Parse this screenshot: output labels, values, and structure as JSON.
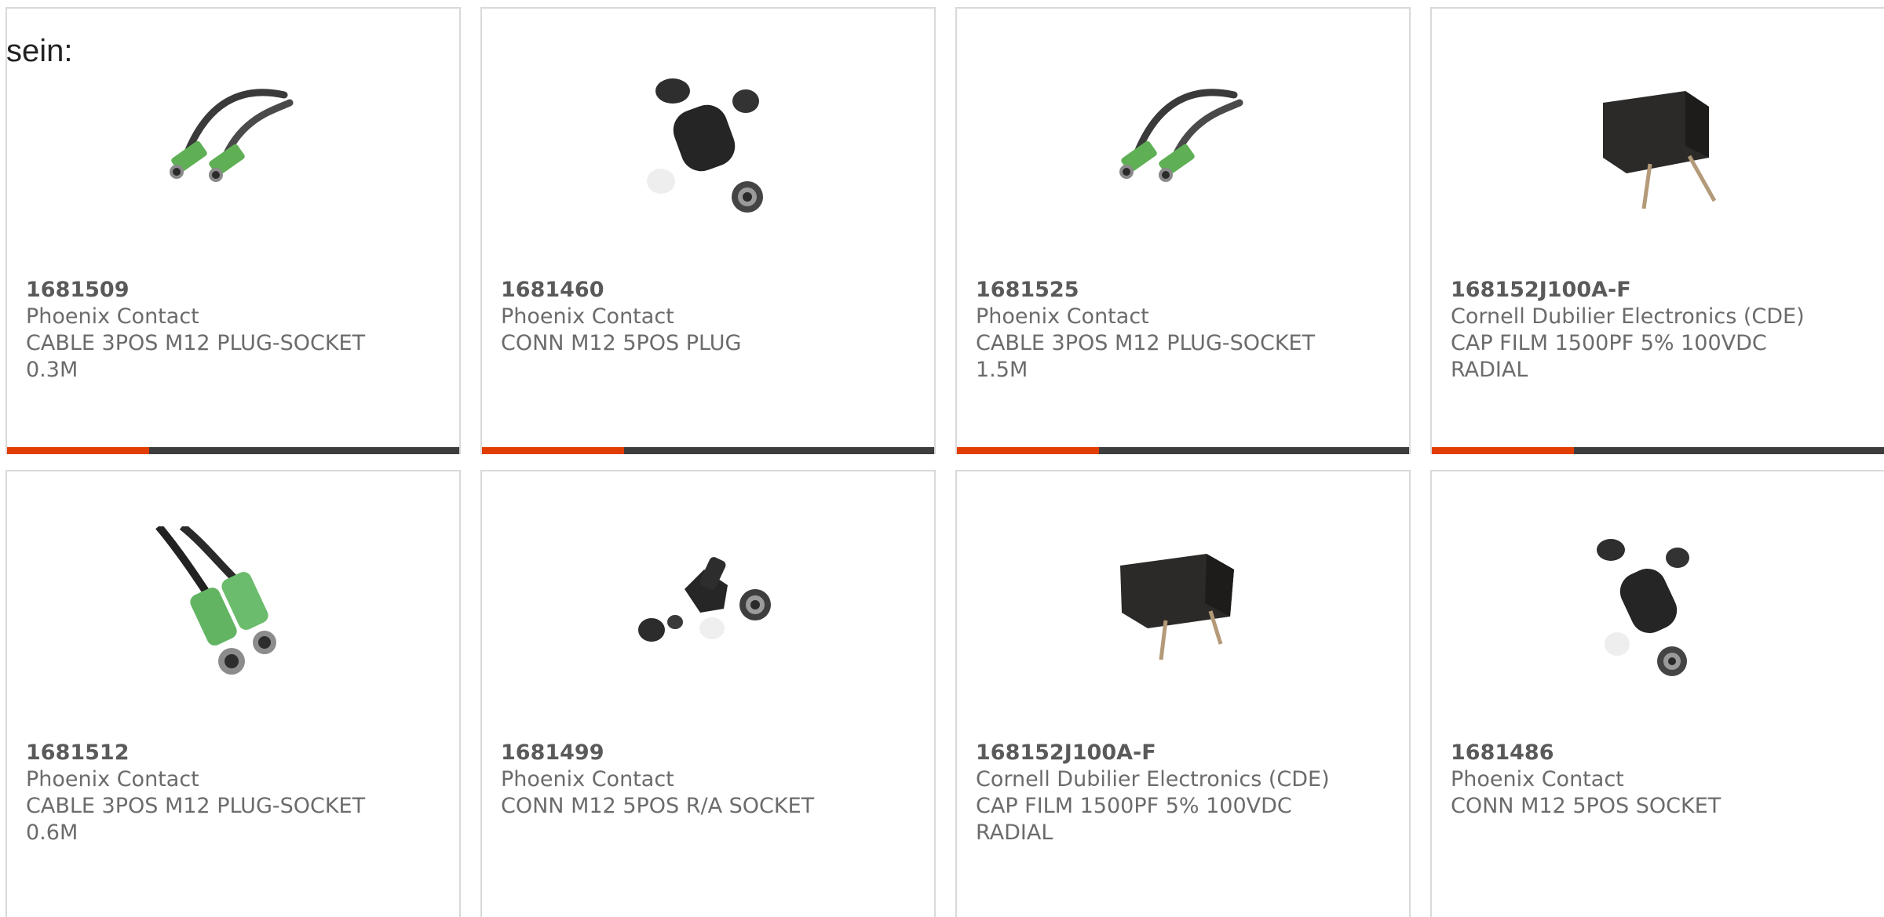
{
  "heading": "sein:",
  "colors": {
    "accent": "#e23d00",
    "bar": "#3d3d3d",
    "border": "#d9d9d9",
    "text": "#6b6b6b"
  },
  "cards": [
    {
      "part_number": "1681509",
      "manufacturer": "Phoenix Contact",
      "desc_line1": "CABLE 3POS M12 PLUG-SOCKET",
      "desc_line2": "0.3M",
      "image": "m12-cable-icon"
    },
    {
      "part_number": "1681460",
      "manufacturer": "Phoenix Contact",
      "desc_line1": "CONN M12 5POS PLUG",
      "desc_line2": "",
      "image": "m12-connector-kit-icon"
    },
    {
      "part_number": "1681525",
      "manufacturer": "Phoenix Contact",
      "desc_line1": "CABLE 3POS M12 PLUG-SOCKET",
      "desc_line2": "1.5M",
      "image": "m12-cable-icon"
    },
    {
      "part_number": "168152J100A-F",
      "manufacturer": "Cornell Dubilier Electronics (CDE)",
      "desc_line1": "CAP FILM 1500PF 5% 100VDC",
      "desc_line2": "RADIAL",
      "image": "film-capacitor-icon"
    },
    {
      "part_number": "1681512",
      "manufacturer": "Phoenix Contact",
      "desc_line1": "CABLE 3POS M12 PLUG-SOCKET",
      "desc_line2": "0.6M",
      "image": "m12-cable-closeup-icon"
    },
    {
      "part_number": "1681499",
      "manufacturer": "Phoenix Contact",
      "desc_line1": "CONN M12 5POS R/A SOCKET",
      "desc_line2": "",
      "image": "m12-right-angle-connector-icon"
    },
    {
      "part_number": "168152J100A-F",
      "manufacturer": "Cornell Dubilier Electronics (CDE)",
      "desc_line1": "CAP FILM 1500PF 5% 100VDC",
      "desc_line2": "RADIAL",
      "image": "film-capacitor-icon"
    },
    {
      "part_number": "1681486",
      "manufacturer": "Phoenix Contact",
      "desc_line1": "CONN M12 5POS SOCKET",
      "desc_line2": "",
      "image": "m12-connector-kit-icon"
    }
  ]
}
